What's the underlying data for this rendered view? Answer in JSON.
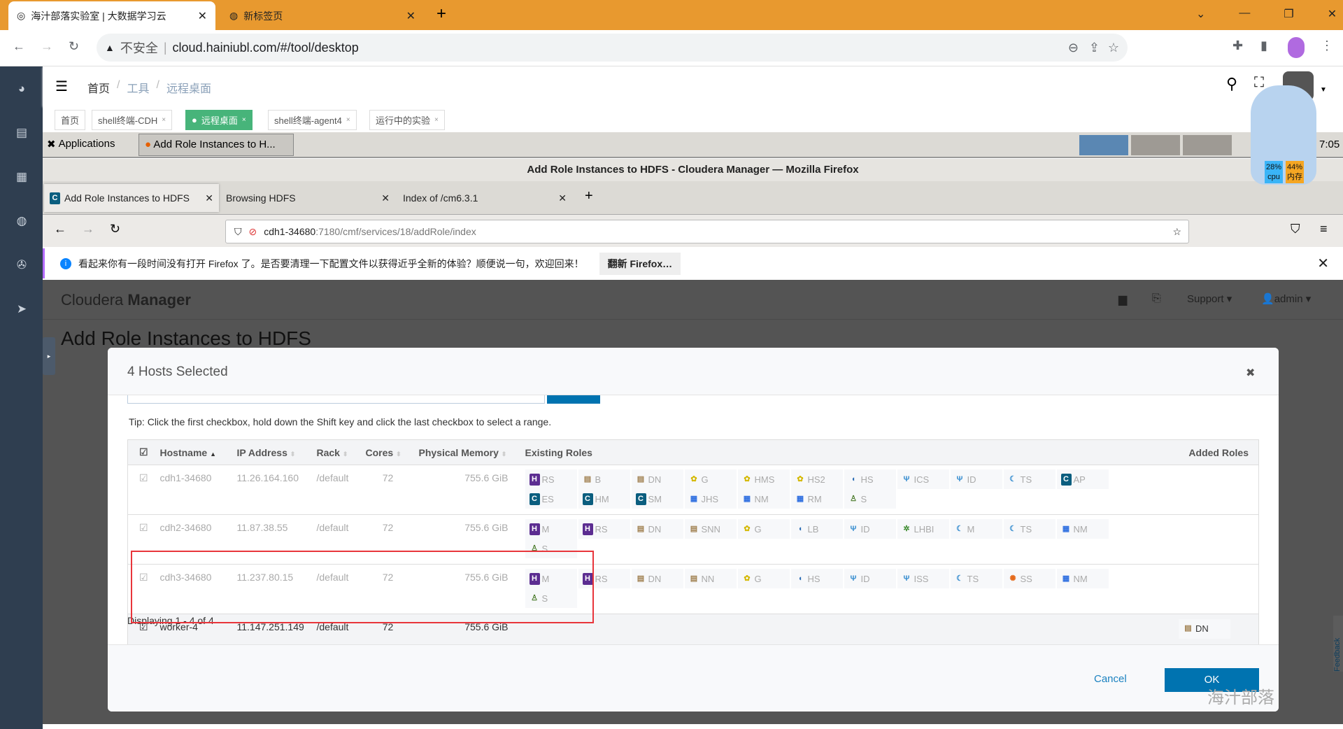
{
  "chrome": {
    "tabs": [
      {
        "label": "海汁部落实验室 | 大数据学习云"
      },
      {
        "label": "新标签页"
      }
    ],
    "security": "不安全",
    "url": "cloud.hainiubl.com/#/tool/desktop",
    "new_tab": "+",
    "win_controls": [
      "⌄",
      "—",
      "❐",
      "✕"
    ]
  },
  "app": {
    "breadcrumb": [
      "首页",
      "工具",
      "远程桌面"
    ],
    "tabs": [
      {
        "label": "首页"
      },
      {
        "label": "shell终端-CDH"
      },
      {
        "label": "远程桌面",
        "active": true
      },
      {
        "label": "shell终端-agent4"
      },
      {
        "label": "运行中的实验"
      }
    ],
    "accent": "#47b47a"
  },
  "desktop": {
    "applications": "Applications",
    "task": "Add Role Instances to H...",
    "clock": "7:05",
    "cpu": "28%",
    "cpu_label": "cpu",
    "mem": "44%",
    "mem_label": "内存"
  },
  "firefox": {
    "title": "Add Role Instances to HDFS - Cloudera Manager — Mozilla Firefox",
    "tabs": [
      {
        "label": "Add Role Instances to HDFS"
      },
      {
        "label": "Browsing HDFS"
      },
      {
        "label": "Index of /cm6.3.1"
      }
    ],
    "url_host": "cdh1-34680",
    "url_rest": ":7180/cmf/services/18/addRole/index",
    "notice": "看起来你有一段时间没有打开 Firefox 了。是否要清理一下配置文件以获得近乎全新的体验？顺便说一句，欢迎回来！",
    "notice_button": "翻新 Firefox…"
  },
  "cm": {
    "brand_light": "Cloudera",
    "brand_bold": "Manager",
    "support": "Support ▾",
    "user": "admin ▾",
    "page_title": "Add Role Instances to HDFS",
    "feedback": "Feedback"
  },
  "modal": {
    "title": "4 Hosts Selected",
    "close": "✖",
    "tip": "Tip: Click the first checkbox, hold down the Shift key and click the last checkbox to select a range.",
    "columns": [
      "Hostname",
      "IP Address",
      "Rack",
      "Cores",
      "Physical Memory",
      "Existing Roles",
      "Added Roles"
    ],
    "rows": [
      {
        "hostname": "cdh1-34680",
        "ip": "11.26.164.160",
        "rack": "/default",
        "cores": "72",
        "memory": "755.6 GiB",
        "checked": true,
        "disabled": true,
        "roles": [
          [
            "hbase",
            "RS"
          ],
          [
            "hdfs",
            "B"
          ],
          [
            "hdfs",
            "DN"
          ],
          [
            "hive",
            "G"
          ],
          [
            "hive",
            "HMS"
          ],
          [
            "hive",
            "HS2"
          ],
          [
            "hue",
            "HS"
          ],
          [
            "impala",
            "ICS"
          ],
          [
            "impala",
            "ID"
          ],
          [
            "kudu",
            "TS"
          ],
          [
            "cm",
            "AP"
          ],
          [
            "cm",
            "ES"
          ],
          [
            "cm",
            "HM"
          ],
          [
            "cm",
            "SM"
          ],
          [
            "yarn",
            "JHS"
          ],
          [
            "yarn",
            "NM"
          ],
          [
            "yarn",
            "RM"
          ],
          [
            "zookeeper",
            "S"
          ]
        ],
        "added": []
      },
      {
        "hostname": "cdh2-34680",
        "ip": "11.87.38.55",
        "rack": "/default",
        "cores": "72",
        "memory": "755.6 GiB",
        "checked": true,
        "disabled": true,
        "roles": [
          [
            "hbase",
            "M"
          ],
          [
            "hbase",
            "RS"
          ],
          [
            "hdfs",
            "DN"
          ],
          [
            "hdfs",
            "SNN"
          ],
          [
            "hive",
            "G"
          ],
          [
            "hue",
            "LB"
          ],
          [
            "impala",
            "ID"
          ],
          [
            "ks_indexer",
            "LHBI"
          ],
          [
            "kudu",
            "M"
          ],
          [
            "kudu",
            "TS"
          ],
          [
            "yarn",
            "NM"
          ],
          [
            "zookeeper",
            "S"
          ]
        ],
        "added": []
      },
      {
        "hostname": "cdh3-34680",
        "ip": "11.237.80.15",
        "rack": "/default",
        "cores": "72",
        "memory": "755.6 GiB",
        "checked": true,
        "disabled": true,
        "roles": [
          [
            "hbase",
            "M"
          ],
          [
            "hbase",
            "RS"
          ],
          [
            "hdfs",
            "DN"
          ],
          [
            "hdfs",
            "NN"
          ],
          [
            "hive",
            "G"
          ],
          [
            "hue",
            "HS"
          ],
          [
            "impala",
            "ID"
          ],
          [
            "impala",
            "ISS"
          ],
          [
            "kudu",
            "TS"
          ],
          [
            "spark",
            "SS"
          ],
          [
            "yarn",
            "NM"
          ],
          [
            "zookeeper",
            "S"
          ]
        ],
        "added": []
      },
      {
        "hostname": "worker-4",
        "ip": "11.147.251.149",
        "rack": "/default",
        "cores": "72",
        "memory": "755.6 GiB",
        "checked": true,
        "disabled": false,
        "roles": [],
        "added": [
          [
            "hdfs",
            "DN"
          ]
        ]
      }
    ],
    "footer": "Displaying 1 - 4 of 4",
    "cancel": "Cancel",
    "ok": "OK"
  },
  "watermark": "海汁部落",
  "role_icons": {
    "hbase": {
      "glyph": "H",
      "color": "#5c2d91"
    },
    "hdfs": {
      "glyph": "▤",
      "color": "#a08050"
    },
    "hive": {
      "glyph": "✿",
      "color": "#d4b800"
    },
    "hue": {
      "glyph": "◖",
      "color": "#2d6db5"
    },
    "impala": {
      "glyph": "Ψ",
      "color": "#3a8fd0"
    },
    "kudu": {
      "glyph": "☾",
      "color": "#3a8fd0"
    },
    "cm": {
      "glyph": "C",
      "color": "#0b5e7f"
    },
    "yarn": {
      "glyph": "▦",
      "color": "#2f6fe0"
    },
    "zookeeper": {
      "glyph": "♙",
      "color": "#4a7a2a"
    },
    "ks_indexer": {
      "glyph": "✲",
      "color": "#3d8b2f"
    },
    "spark": {
      "glyph": "✺",
      "color": "#e56a1b"
    }
  },
  "colors": {
    "chrome_tab_bar": "#e8992f",
    "sidebar": "#2f3e50",
    "ok_button": "#0073b0",
    "highlight_box": "#e8353b"
  }
}
